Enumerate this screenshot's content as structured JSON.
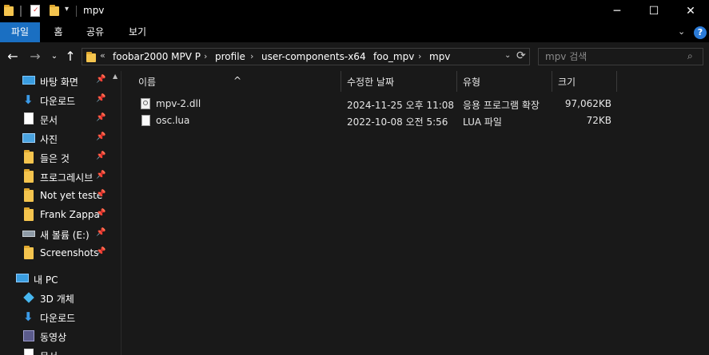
{
  "window": {
    "title": "mpv",
    "controls": {
      "minimize": "─",
      "maximize": "☐",
      "close": "✕"
    }
  },
  "ribbon": {
    "tabs": [
      {
        "label": "파일",
        "active": true
      },
      {
        "label": "홈",
        "active": false
      },
      {
        "label": "공유",
        "active": false
      },
      {
        "label": "보기",
        "active": false
      }
    ],
    "help_icon": "?"
  },
  "address": {
    "overflow": "«",
    "crumbs": [
      "foobar2000 MPV P",
      "profile",
      "user-components-x64",
      "foo_mpv",
      "mpv"
    ],
    "separator": "›",
    "refresh_icon": "⟳"
  },
  "search": {
    "placeholder": "mpv 검색"
  },
  "sidebar": {
    "quick_access": [
      {
        "label": "바탕 화면",
        "icon": "desktop-icon",
        "pinned": true
      },
      {
        "label": "다운로드",
        "icon": "download-icon",
        "pinned": true
      },
      {
        "label": "문서",
        "icon": "documents-icon",
        "pinned": true
      },
      {
        "label": "사진",
        "icon": "pictures-icon",
        "pinned": true
      },
      {
        "label": "들은 것",
        "icon": "folder-icon",
        "pinned": true
      },
      {
        "label": "프로그레시브",
        "icon": "folder-icon",
        "pinned": true
      },
      {
        "label": "Not yet teste",
        "icon": "folder-icon",
        "pinned": true
      },
      {
        "label": "Frank Zappa",
        "icon": "folder-icon",
        "pinned": true
      },
      {
        "label": "새 볼륨 (E:)",
        "icon": "drive-icon",
        "pinned": true
      },
      {
        "label": "Screenshots",
        "icon": "folder-icon",
        "pinned": true
      }
    ],
    "this_pc": {
      "label": "내 PC",
      "items": [
        {
          "label": "3D 개체",
          "icon": "3d-objects-icon"
        },
        {
          "label": "다운로드",
          "icon": "download-icon"
        },
        {
          "label": "동영상",
          "icon": "videos-icon"
        },
        {
          "label": "문서",
          "icon": "documents-icon"
        }
      ]
    }
  },
  "columns": {
    "name": "이름",
    "modified": "수정한 날짜",
    "type": "유형",
    "size": "크기"
  },
  "files": [
    {
      "name": "mpv-2.dll",
      "modified": "2024-11-25 오후 11:08",
      "type": "응용 프로그램 확장",
      "size": "97,062KB",
      "icon": "dll-file-icon"
    },
    {
      "name": "osc.lua",
      "modified": "2022-10-08 오전 5:56",
      "type": "LUA 파일",
      "size": "72KB",
      "icon": "text-file-icon"
    }
  ]
}
